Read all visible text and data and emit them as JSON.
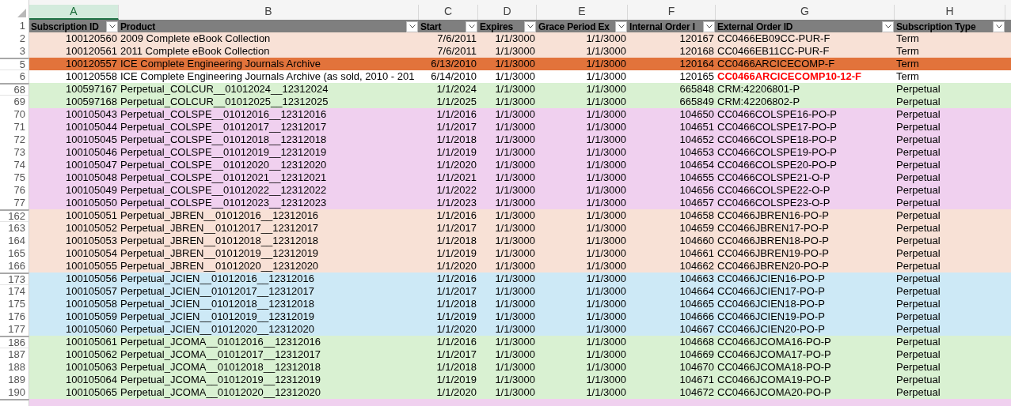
{
  "columns": [
    {
      "letter": "A",
      "selected": true
    },
    {
      "letter": "B",
      "selected": false
    },
    {
      "letter": "C",
      "selected": false
    },
    {
      "letter": "D",
      "selected": false
    },
    {
      "letter": "E",
      "selected": false
    },
    {
      "letter": "F",
      "selected": false
    },
    {
      "letter": "G",
      "selected": false
    },
    {
      "letter": "H",
      "selected": false
    }
  ],
  "header": {
    "row": "1",
    "cells": [
      "Subscription ID",
      "Product",
      "Start",
      "Expires",
      "Grace Period Ex",
      "Internal Order I",
      "External Order ID",
      "Subscription Type"
    ]
  },
  "rows": [
    {
      "row": "2",
      "color": "#f8e1d6",
      "gap_before": false,
      "alert": false,
      "external_flagged": false,
      "cells": [
        "100120560",
        "2009 Complete eBook Collection",
        "7/6/2011",
        "1/1/3000",
        "1/1/3000",
        "120167",
        "CC0466EB09CC-PUR-F",
        "Term"
      ]
    },
    {
      "row": "3",
      "color": "#f8e1d6",
      "gap_before": false,
      "alert": false,
      "external_flagged": false,
      "cells": [
        "100120561",
        "2011 Complete eBook Collection",
        "7/6/2011",
        "1/1/3000",
        "1/1/3000",
        "120168",
        "CC0466EB11CC-PUR-F",
        "Term"
      ]
    },
    {
      "row": "5",
      "color": "#e2733b",
      "gap_before": true,
      "alert": false,
      "external_flagged": false,
      "cells": [
        "100120557",
        "ICE Complete Engineering Journals Archive",
        "6/13/2010",
        "1/1/3000",
        "1/1/3000",
        "120164",
        "CC0466ARCICECOMP-F",
        "Term"
      ]
    },
    {
      "row": "6",
      "color": "#ffffff",
      "gap_before": false,
      "alert": false,
      "external_flagged": true,
      "cells": [
        "100120558",
        "ICE Complete Engineering Journals Archive (as sold, 2010 - 201",
        "6/14/2010",
        "1/1/3000",
        "1/1/3000",
        "120165",
        "CC0466ARCICECOMP10-12-F",
        "Term"
      ]
    },
    {
      "row": "68",
      "color": "#d9f1d2",
      "gap_before": true,
      "alert": false,
      "external_flagged": false,
      "cells": [
        "100597167",
        "Perpetual_COLCUR__01012024__12312024",
        "1/1/2024",
        "1/1/3000",
        "1/1/3000",
        "665848",
        "CRM:42206801-P",
        "Perpetual"
      ]
    },
    {
      "row": "69",
      "color": "#d9f1d2",
      "gap_before": false,
      "alert": false,
      "external_flagged": false,
      "cells": [
        "100597168",
        "Perpetual_COLCUR__01012025__12312025",
        "1/1/2025",
        "1/1/3000",
        "1/1/3000",
        "665849",
        "CRM:42206802-P",
        "Perpetual"
      ]
    },
    {
      "row": "70",
      "color": "#f0d0ef",
      "gap_before": false,
      "alert": false,
      "external_flagged": false,
      "cells": [
        "100105043",
        "Perpetual_COLSPE__01012016__12312016",
        "1/1/2016",
        "1/1/3000",
        "1/1/3000",
        "104650",
        "CC0466COLSPE16-PO-P",
        "Perpetual"
      ]
    },
    {
      "row": "71",
      "color": "#f0d0ef",
      "gap_before": false,
      "alert": false,
      "external_flagged": false,
      "cells": [
        "100105044",
        "Perpetual_COLSPE__01012017__12312017",
        "1/1/2017",
        "1/1/3000",
        "1/1/3000",
        "104651",
        "CC0466COLSPE17-PO-P",
        "Perpetual"
      ]
    },
    {
      "row": "72",
      "color": "#f0d0ef",
      "gap_before": false,
      "alert": false,
      "external_flagged": false,
      "cells": [
        "100105045",
        "Perpetual_COLSPE__01012018__12312018",
        "1/1/2018",
        "1/1/3000",
        "1/1/3000",
        "104652",
        "CC0466COLSPE18-PO-P",
        "Perpetual"
      ]
    },
    {
      "row": "73",
      "color": "#f0d0ef",
      "gap_before": false,
      "alert": false,
      "external_flagged": false,
      "cells": [
        "100105046",
        "Perpetual_COLSPE__01012019__12312019",
        "1/1/2019",
        "1/1/3000",
        "1/1/3000",
        "104653",
        "CC0466COLSPE19-PO-P",
        "Perpetual"
      ]
    },
    {
      "row": "74",
      "color": "#f0d0ef",
      "gap_before": false,
      "alert": false,
      "external_flagged": false,
      "cells": [
        "100105047",
        "Perpetual_COLSPE__01012020__12312020",
        "1/1/2020",
        "1/1/3000",
        "1/1/3000",
        "104654",
        "CC0466COLSPE20-PO-P",
        "Perpetual"
      ]
    },
    {
      "row": "75",
      "color": "#f0d0ef",
      "gap_before": false,
      "alert": false,
      "external_flagged": false,
      "cells": [
        "100105048",
        "Perpetual_COLSPE__01012021__12312021",
        "1/1/2021",
        "1/1/3000",
        "1/1/3000",
        "104655",
        "CC0466COLSPE21-O-P",
        "Perpetual"
      ]
    },
    {
      "row": "76",
      "color": "#f0d0ef",
      "gap_before": false,
      "alert": false,
      "external_flagged": false,
      "cells": [
        "100105049",
        "Perpetual_COLSPE__01012022__12312022",
        "1/1/2022",
        "1/1/3000",
        "1/1/3000",
        "104656",
        "CC0466COLSPE22-O-P",
        "Perpetual"
      ]
    },
    {
      "row": "77",
      "color": "#f0d0ef",
      "gap_before": false,
      "alert": false,
      "external_flagged": false,
      "cells": [
        "100105050",
        "Perpetual_COLSPE__01012023__12312023",
        "1/1/2023",
        "1/1/3000",
        "1/1/3000",
        "104657",
        "CC0466COLSPE23-O-P",
        "Perpetual"
      ]
    },
    {
      "row": "162",
      "color": "#f8e1d6",
      "gap_before": true,
      "alert": false,
      "external_flagged": false,
      "cells": [
        "100105051",
        "Perpetual_JBREN__01012016__12312016",
        "1/1/2016",
        "1/1/3000",
        "1/1/3000",
        "104658",
        "CC0466JBREN16-PO-P",
        "Perpetual"
      ]
    },
    {
      "row": "163",
      "color": "#f8e1d6",
      "gap_before": false,
      "alert": false,
      "external_flagged": false,
      "cells": [
        "100105052",
        "Perpetual_JBREN__01012017__12312017",
        "1/1/2017",
        "1/1/3000",
        "1/1/3000",
        "104659",
        "CC0466JBREN17-PO-P",
        "Perpetual"
      ]
    },
    {
      "row": "164",
      "color": "#f8e1d6",
      "gap_before": false,
      "alert": false,
      "external_flagged": false,
      "cells": [
        "100105053",
        "Perpetual_JBREN__01012018__12312018",
        "1/1/2018",
        "1/1/3000",
        "1/1/3000",
        "104660",
        "CC0466JBREN18-PO-P",
        "Perpetual"
      ]
    },
    {
      "row": "165",
      "color": "#f8e1d6",
      "gap_before": false,
      "alert": false,
      "external_flagged": false,
      "cells": [
        "100105054",
        "Perpetual_JBREN__01012019__12312019",
        "1/1/2019",
        "1/1/3000",
        "1/1/3000",
        "104661",
        "CC0466JBREN19-PO-P",
        "Perpetual"
      ]
    },
    {
      "row": "166",
      "color": "#f8e1d6",
      "gap_before": false,
      "alert": false,
      "external_flagged": false,
      "cells": [
        "100105055",
        "Perpetual_JBREN__01012020__12312020",
        "1/1/2020",
        "1/1/3000",
        "1/1/3000",
        "104662",
        "CC0466JBREN20-PO-P",
        "Perpetual"
      ]
    },
    {
      "row": "173",
      "color": "#cde9f6",
      "gap_before": true,
      "alert": false,
      "external_flagged": false,
      "cells": [
        "100105056",
        "Perpetual_JCIEN__01012016__12312016",
        "1/1/2016",
        "1/1/3000",
        "1/1/3000",
        "104663",
        "CC0466JCIEN16-PO-P",
        "Perpetual"
      ]
    },
    {
      "row": "174",
      "color": "#cde9f6",
      "gap_before": false,
      "alert": false,
      "external_flagged": false,
      "cells": [
        "100105057",
        "Perpetual_JCIEN__01012017__12312017",
        "1/1/2017",
        "1/1/3000",
        "1/1/3000",
        "104664",
        "CC0466JCIEN17-PO-P",
        "Perpetual"
      ]
    },
    {
      "row": "175",
      "color": "#cde9f6",
      "gap_before": false,
      "alert": false,
      "external_flagged": false,
      "cells": [
        "100105058",
        "Perpetual_JCIEN__01012018__12312018",
        "1/1/2018",
        "1/1/3000",
        "1/1/3000",
        "104665",
        "CC0466JCIEN18-PO-P",
        "Perpetual"
      ]
    },
    {
      "row": "176",
      "color": "#cde9f6",
      "gap_before": false,
      "alert": false,
      "external_flagged": false,
      "cells": [
        "100105059",
        "Perpetual_JCIEN__01012019__12312019",
        "1/1/2019",
        "1/1/3000",
        "1/1/3000",
        "104666",
        "CC0466JCIEN19-PO-P",
        "Perpetual"
      ]
    },
    {
      "row": "177",
      "color": "#cde9f6",
      "gap_before": false,
      "alert": false,
      "external_flagged": false,
      "cells": [
        "100105060",
        "Perpetual_JCIEN__01012020__12312020",
        "1/1/2020",
        "1/1/3000",
        "1/1/3000",
        "104667",
        "CC0466JCIEN20-PO-P",
        "Perpetual"
      ]
    },
    {
      "row": "186",
      "color": "#d9f1d2",
      "gap_before": true,
      "alert": false,
      "external_flagged": false,
      "cells": [
        "100105061",
        "Perpetual_JCOMA__01012016__12312016",
        "1/1/2016",
        "1/1/3000",
        "1/1/3000",
        "104668",
        "CC0466JCOMA16-PO-P",
        "Perpetual"
      ]
    },
    {
      "row": "187",
      "color": "#d9f1d2",
      "gap_before": false,
      "alert": false,
      "external_flagged": false,
      "cells": [
        "100105062",
        "Perpetual_JCOMA__01012017__12312017",
        "1/1/2017",
        "1/1/3000",
        "1/1/3000",
        "104669",
        "CC0466JCOMA17-PO-P",
        "Perpetual"
      ]
    },
    {
      "row": "188",
      "color": "#d9f1d2",
      "gap_before": false,
      "alert": false,
      "external_flagged": false,
      "cells": [
        "100105063",
        "Perpetual_JCOMA__01012018__12312018",
        "1/1/2018",
        "1/1/3000",
        "1/1/3000",
        "104670",
        "CC0466JCOMA18-PO-P",
        "Perpetual"
      ]
    },
    {
      "row": "189",
      "color": "#d9f1d2",
      "gap_before": false,
      "alert": false,
      "external_flagged": false,
      "cells": [
        "100105064",
        "Perpetual_JCOMA__01012019__12312019",
        "1/1/2019",
        "1/1/3000",
        "1/1/3000",
        "104671",
        "CC0466JCOMA19-PO-P",
        "Perpetual"
      ]
    },
    {
      "row": "190",
      "color": "#d9f1d2",
      "gap_before": false,
      "alert": false,
      "external_flagged": false,
      "cells": [
        "100105065",
        "Perpetual_JCOMA__01012020__12312020",
        "1/1/2020",
        "1/1/3000",
        "1/1/3000",
        "104672",
        "CC0466JCOMA20-PO-P",
        "Perpetual"
      ]
    },
    {
      "color": "#f0d0ef",
      "gap_before": true
    }
  ]
}
